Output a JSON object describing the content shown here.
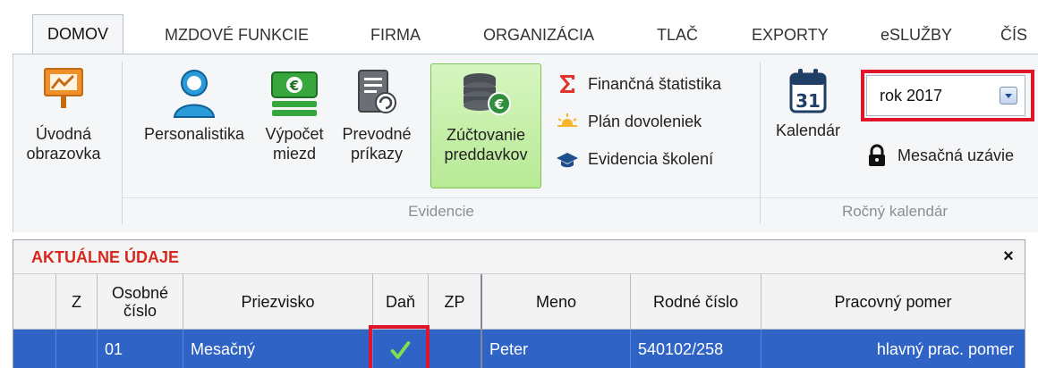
{
  "tabs": [
    "DOMOV",
    "MZDOVÉ FUNKCIE",
    "FIRMA",
    "ORGANIZÁCIA",
    "TLAČ",
    "EXPORTY",
    "eSLUŽBY",
    "ČÍS"
  ],
  "ribbon": {
    "home": {
      "label_line1": "Úvodná",
      "label_line2": "obrazovka"
    },
    "evidencie": {
      "group_label": "Evidencie",
      "personalistika": "Personalistika",
      "vypocet_line1": "Výpočet",
      "vypocet_line2": "miezd",
      "prevodne_line1": "Prevodné",
      "prevodne_line2": "príkazy",
      "zuctovanie_line1": "Zúčtovanie",
      "zuctovanie_line2": "preddavkov",
      "financna": "Finančná štatistika",
      "plan": "Plán dovoleniek",
      "skolenia": "Evidencia školení"
    },
    "rocny": {
      "group_label": "Ročný kalendár",
      "kalendar": "Kalendár",
      "calendar_number": "31",
      "year_select_value": "rok 2017",
      "mesacna": "Mesačná uzávie"
    }
  },
  "panel": {
    "title": "AKTUÁLNE ÚDAJE",
    "close": "×",
    "columns": {
      "z": "Z",
      "osobne_line1": "Osobné",
      "osobne_line2": "číslo",
      "priezvisko": "Priezvisko",
      "dan": "Daň",
      "zp": "ZP",
      "meno": "Meno",
      "rodne": "Rodné číslo",
      "pomer": "Pracovný pomer"
    },
    "rows": [
      {
        "osobne_cislo": "01",
        "priezvisko": "Mesačný",
        "dan_checked": true,
        "meno": "Peter",
        "rodne_cislo": "540102/258",
        "pracovny_pomer": "hlavný prac. pomer"
      }
    ]
  },
  "colors": {
    "accent_red": "#e0152a",
    "title_red": "#d8281e",
    "row_selected": "#2f63c5",
    "selected_button": "#b8ea96"
  },
  "icons": [
    "home-screen-icon",
    "person-icon",
    "money-icon",
    "payment-order-icon",
    "coins-euro-icon",
    "sigma-icon",
    "sun-icon",
    "graduation-cap-icon",
    "calendar-icon",
    "lock-icon",
    "dropdown-arrow-icon",
    "checkmark-icon",
    "close-icon"
  ]
}
